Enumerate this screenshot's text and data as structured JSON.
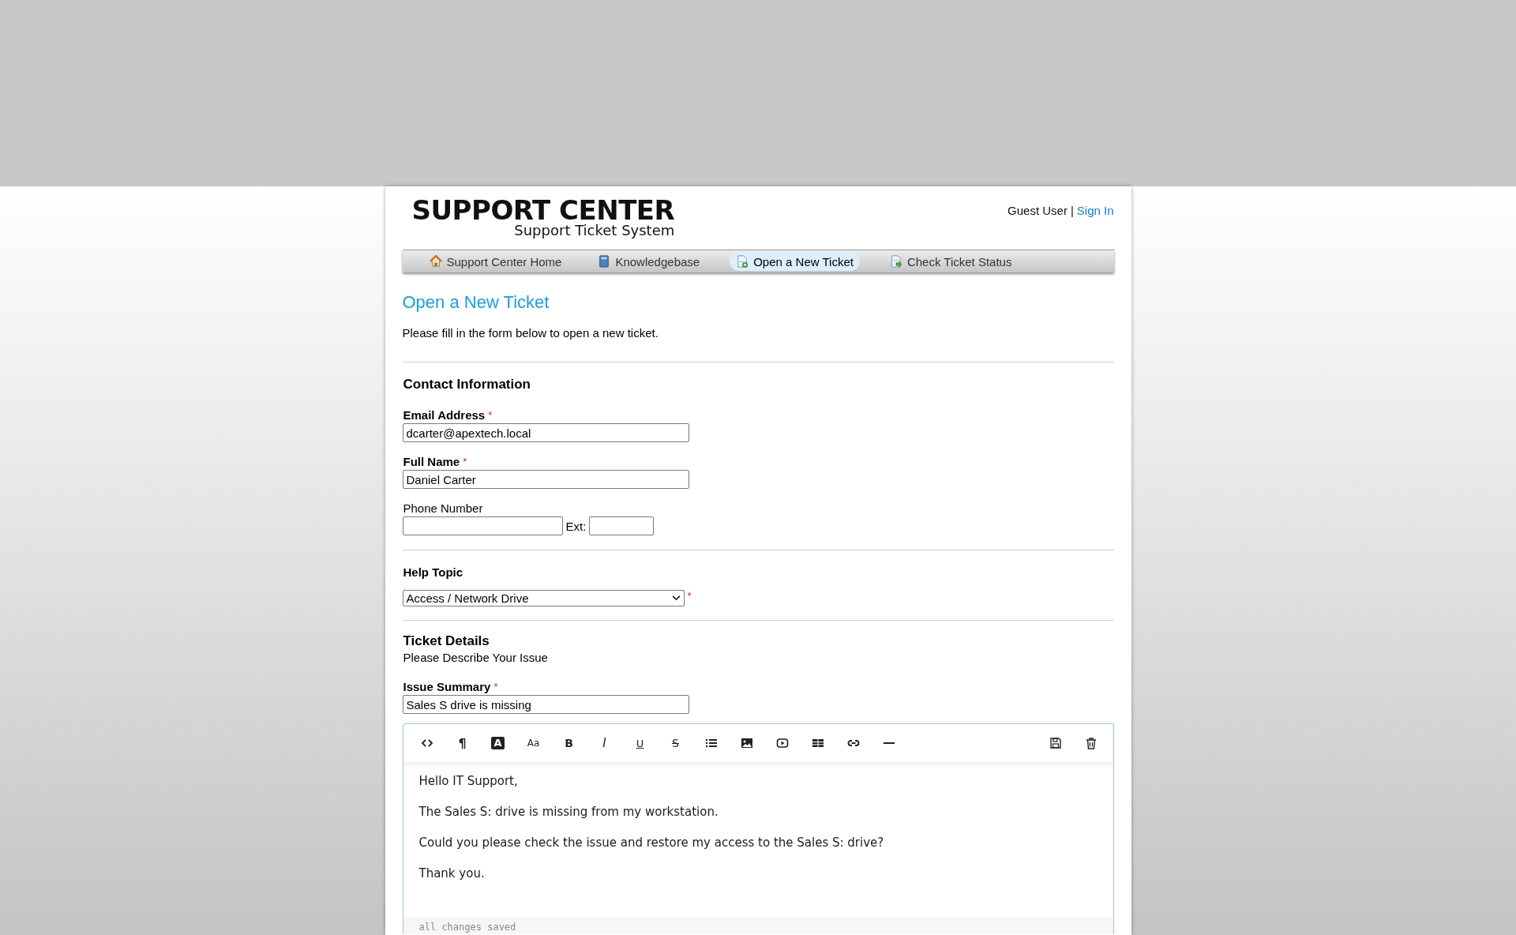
{
  "header": {
    "title": "SUPPORT CENTER",
    "subtitle": "Support Ticket System",
    "user": "Guest User",
    "separator": "|",
    "sign_in": "Sign In"
  },
  "nav": [
    {
      "kind": "home",
      "label": "Support Center Home",
      "selected": false
    },
    {
      "kind": "book",
      "label": "Knowledgebase",
      "selected": false
    },
    {
      "kind": "new",
      "label": "Open a New Ticket",
      "selected": true
    },
    {
      "kind": "status",
      "label": "Check Ticket Status",
      "selected": false
    }
  ],
  "page": {
    "title": "Open a New Ticket",
    "intro": "Please fill in the form below to open a new ticket."
  },
  "contact": {
    "heading": "Contact Information",
    "fields": [
      {
        "kind": "text",
        "label": "Email Address",
        "required_mark": "*",
        "value": "dcarter@apextech.local"
      },
      {
        "kind": "text",
        "label": "Full Name",
        "required_mark": "*",
        "value": "Daniel Carter"
      },
      {
        "kind": "phone",
        "label": "Phone Number",
        "ext_label": "Ext:"
      }
    ]
  },
  "help_topic": {
    "heading": "Help Topic",
    "value": "Access / Network Drive",
    "required_mark": "*"
  },
  "details": {
    "heading": "Ticket Details",
    "subheading": "Please Describe Your Issue",
    "summary": {
      "label": "Issue Summary",
      "required_mark": "*",
      "value": "Sales S drive is missing"
    }
  },
  "editor": {
    "toolbar": [
      {
        "kind": "code"
      },
      {
        "kind": "paragraph",
        "label": "¶"
      },
      {
        "kind": "highlight",
        "label": "A"
      },
      {
        "kind": "size",
        "label": "Aa"
      },
      {
        "kind": "bold",
        "label": "B"
      },
      {
        "kind": "italic",
        "label": "I"
      },
      {
        "kind": "underline",
        "label": "U"
      },
      {
        "kind": "strike",
        "label": "S"
      },
      {
        "kind": "list"
      },
      {
        "kind": "image"
      },
      {
        "kind": "video"
      },
      {
        "kind": "table"
      },
      {
        "kind": "link"
      },
      {
        "kind": "rule"
      }
    ],
    "toolbar_right": [
      {
        "kind": "save"
      },
      {
        "kind": "delete"
      }
    ],
    "paragraphs": [
      "Hello IT Support,",
      "The Sales S: drive is missing from my workstation.",
      "Could you please check the issue and restore my access to the Sales S: drive?",
      "Thank you."
    ],
    "status": "all changes saved"
  }
}
